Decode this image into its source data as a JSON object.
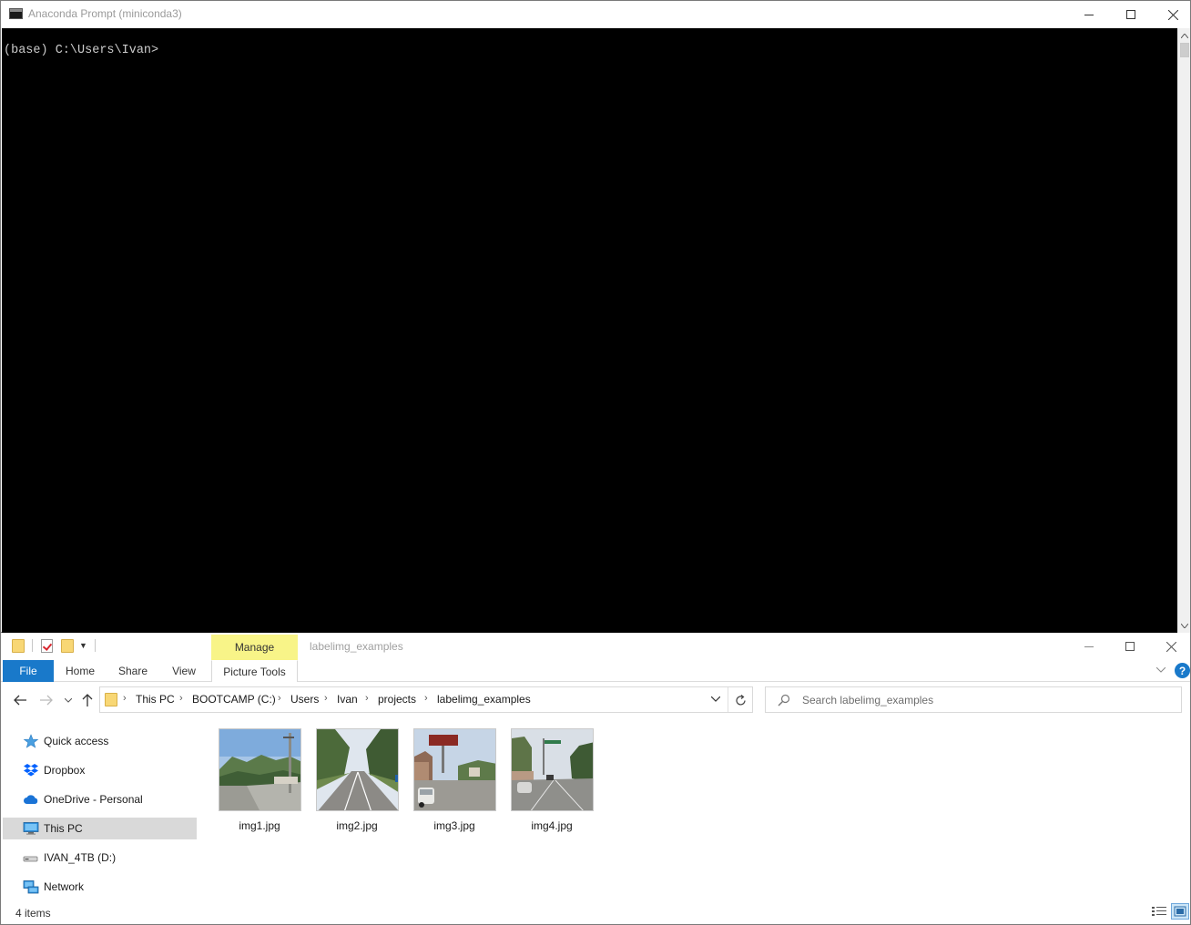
{
  "console": {
    "title": "Anaconda Prompt (miniconda3)",
    "prompt_line": "(base) C:\\Users\\Ivan>",
    "icon": "terminal-icon"
  },
  "explorer": {
    "title": "labelimg_examples",
    "context_tab": "Manage",
    "tabs": {
      "file": "File",
      "home": "Home",
      "share": "Share",
      "view": "View",
      "picture_tools": "Picture Tools"
    },
    "help_label": "?",
    "breadcrumb": [
      "This PC",
      "BOOTCAMP (C:)",
      "Users",
      "Ivan",
      "projects",
      "labelimg_examples"
    ],
    "search_placeholder": "Search labelimg_examples",
    "nav": [
      {
        "label": "Quick access",
        "icon": "star-icon"
      },
      {
        "label": "Dropbox",
        "icon": "dropbox-icon"
      },
      {
        "label": "OneDrive - Personal",
        "icon": "cloud-icon"
      },
      {
        "label": "This PC",
        "icon": "computer-icon",
        "selected": true
      },
      {
        "label": "IVAN_4TB (D:)",
        "icon": "drive-icon"
      },
      {
        "label": "Network",
        "icon": "network-icon"
      }
    ],
    "files": [
      {
        "name": "img1.jpg"
      },
      {
        "name": "img2.jpg"
      },
      {
        "name": "img3.jpg"
      },
      {
        "name": "img4.jpg"
      }
    ],
    "status": "4 items"
  },
  "colors": {
    "accent": "#1979ca",
    "context_tab": "#f8f488",
    "terminal_bg": "#000000",
    "terminal_fg": "#cccccc",
    "selected_nav": "#d9d9d9"
  }
}
